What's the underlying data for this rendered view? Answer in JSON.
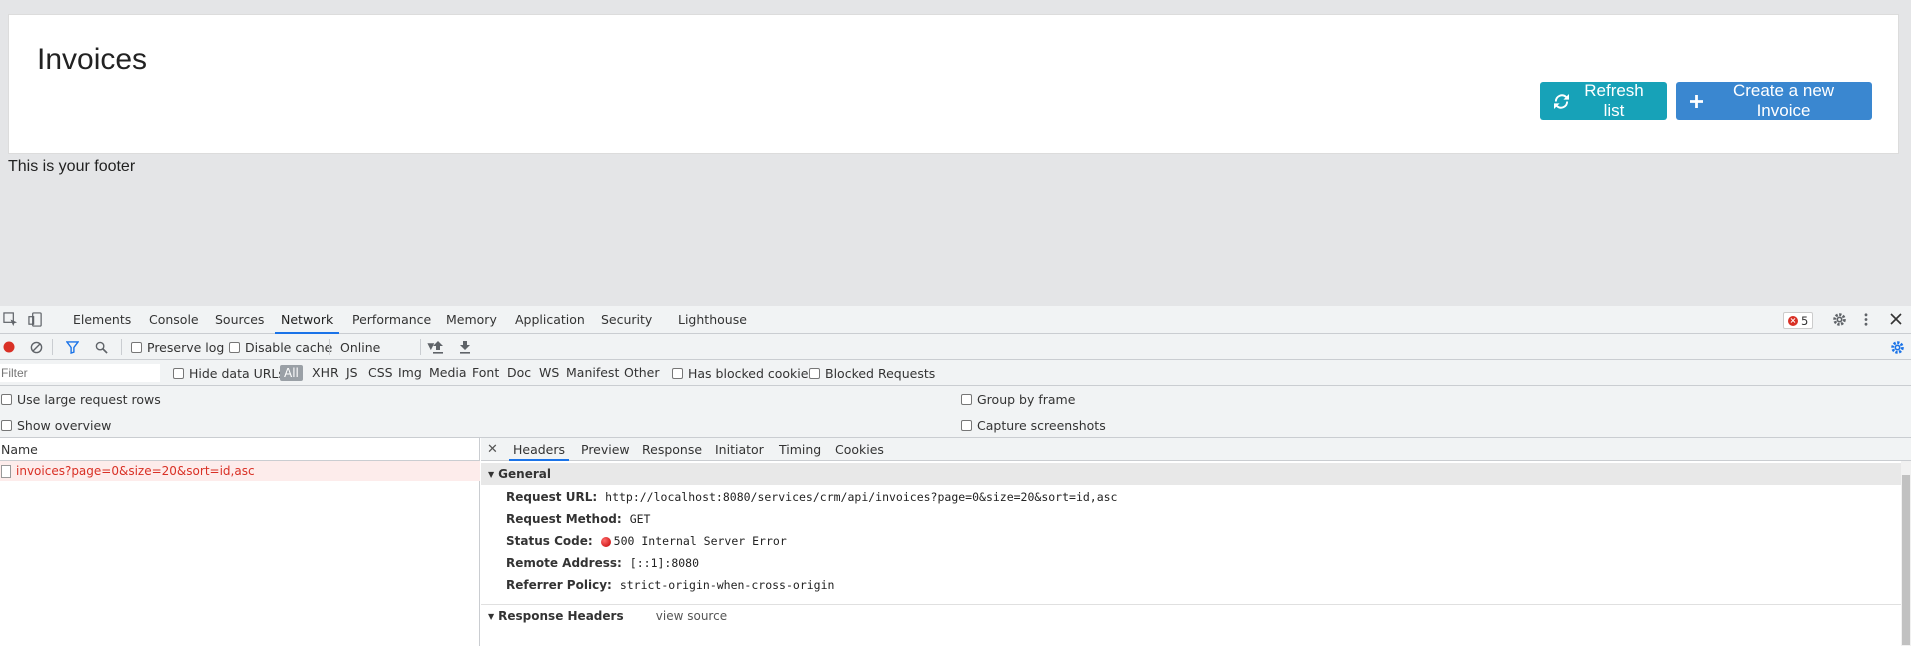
{
  "page": {
    "title": "Invoices",
    "refresh_label": "Refresh list",
    "create_label": "Create a new Invoice",
    "footer": "This is your footer"
  },
  "devtools": {
    "tabs": [
      "Elements",
      "Console",
      "Sources",
      "Network",
      "Performance",
      "Memory",
      "Application",
      "Security",
      "Lighthouse"
    ],
    "active_tab": "Network",
    "error_count": "5",
    "toolbar": {
      "preserve_log": "Preserve log",
      "disable_cache": "Disable cache",
      "throttle": "Online"
    },
    "filter": {
      "placeholder": "Filter",
      "hide_data_urls": "Hide data URLs",
      "types": [
        "All",
        "XHR",
        "JS",
        "CSS",
        "Img",
        "Media",
        "Font",
        "Doc",
        "WS",
        "Manifest",
        "Other"
      ],
      "has_blocked_cookies": "Has blocked cookies",
      "blocked_requests": "Blocked Requests"
    },
    "settings": {
      "large_rows": "Use large request rows",
      "show_overview": "Show overview",
      "group_by_frame": "Group by frame",
      "capture_screenshots": "Capture screenshots"
    },
    "requests": {
      "name_header": "Name",
      "rows": [
        "invoices?page=0&size=20&sort=id,asc"
      ]
    },
    "details": {
      "tabs": [
        "Headers",
        "Preview",
        "Response",
        "Initiator",
        "Timing",
        "Cookies"
      ],
      "active_tab": "Headers",
      "general_title": "General",
      "general": [
        {
          "k": "Request URL:",
          "v": "http://localhost:8080/services/crm/api/invoices?page=0&size=20&sort=id,asc"
        },
        {
          "k": "Request Method:",
          "v": "GET"
        },
        {
          "k": "Status Code:",
          "v": "500 Internal Server Error"
        },
        {
          "k": "Remote Address:",
          "v": "[::1]:8080"
        },
        {
          "k": "Referrer Policy:",
          "v": "strict-origin-when-cross-origin"
        }
      ],
      "response_headers_title": "Response Headers",
      "view_source": "view source"
    }
  }
}
